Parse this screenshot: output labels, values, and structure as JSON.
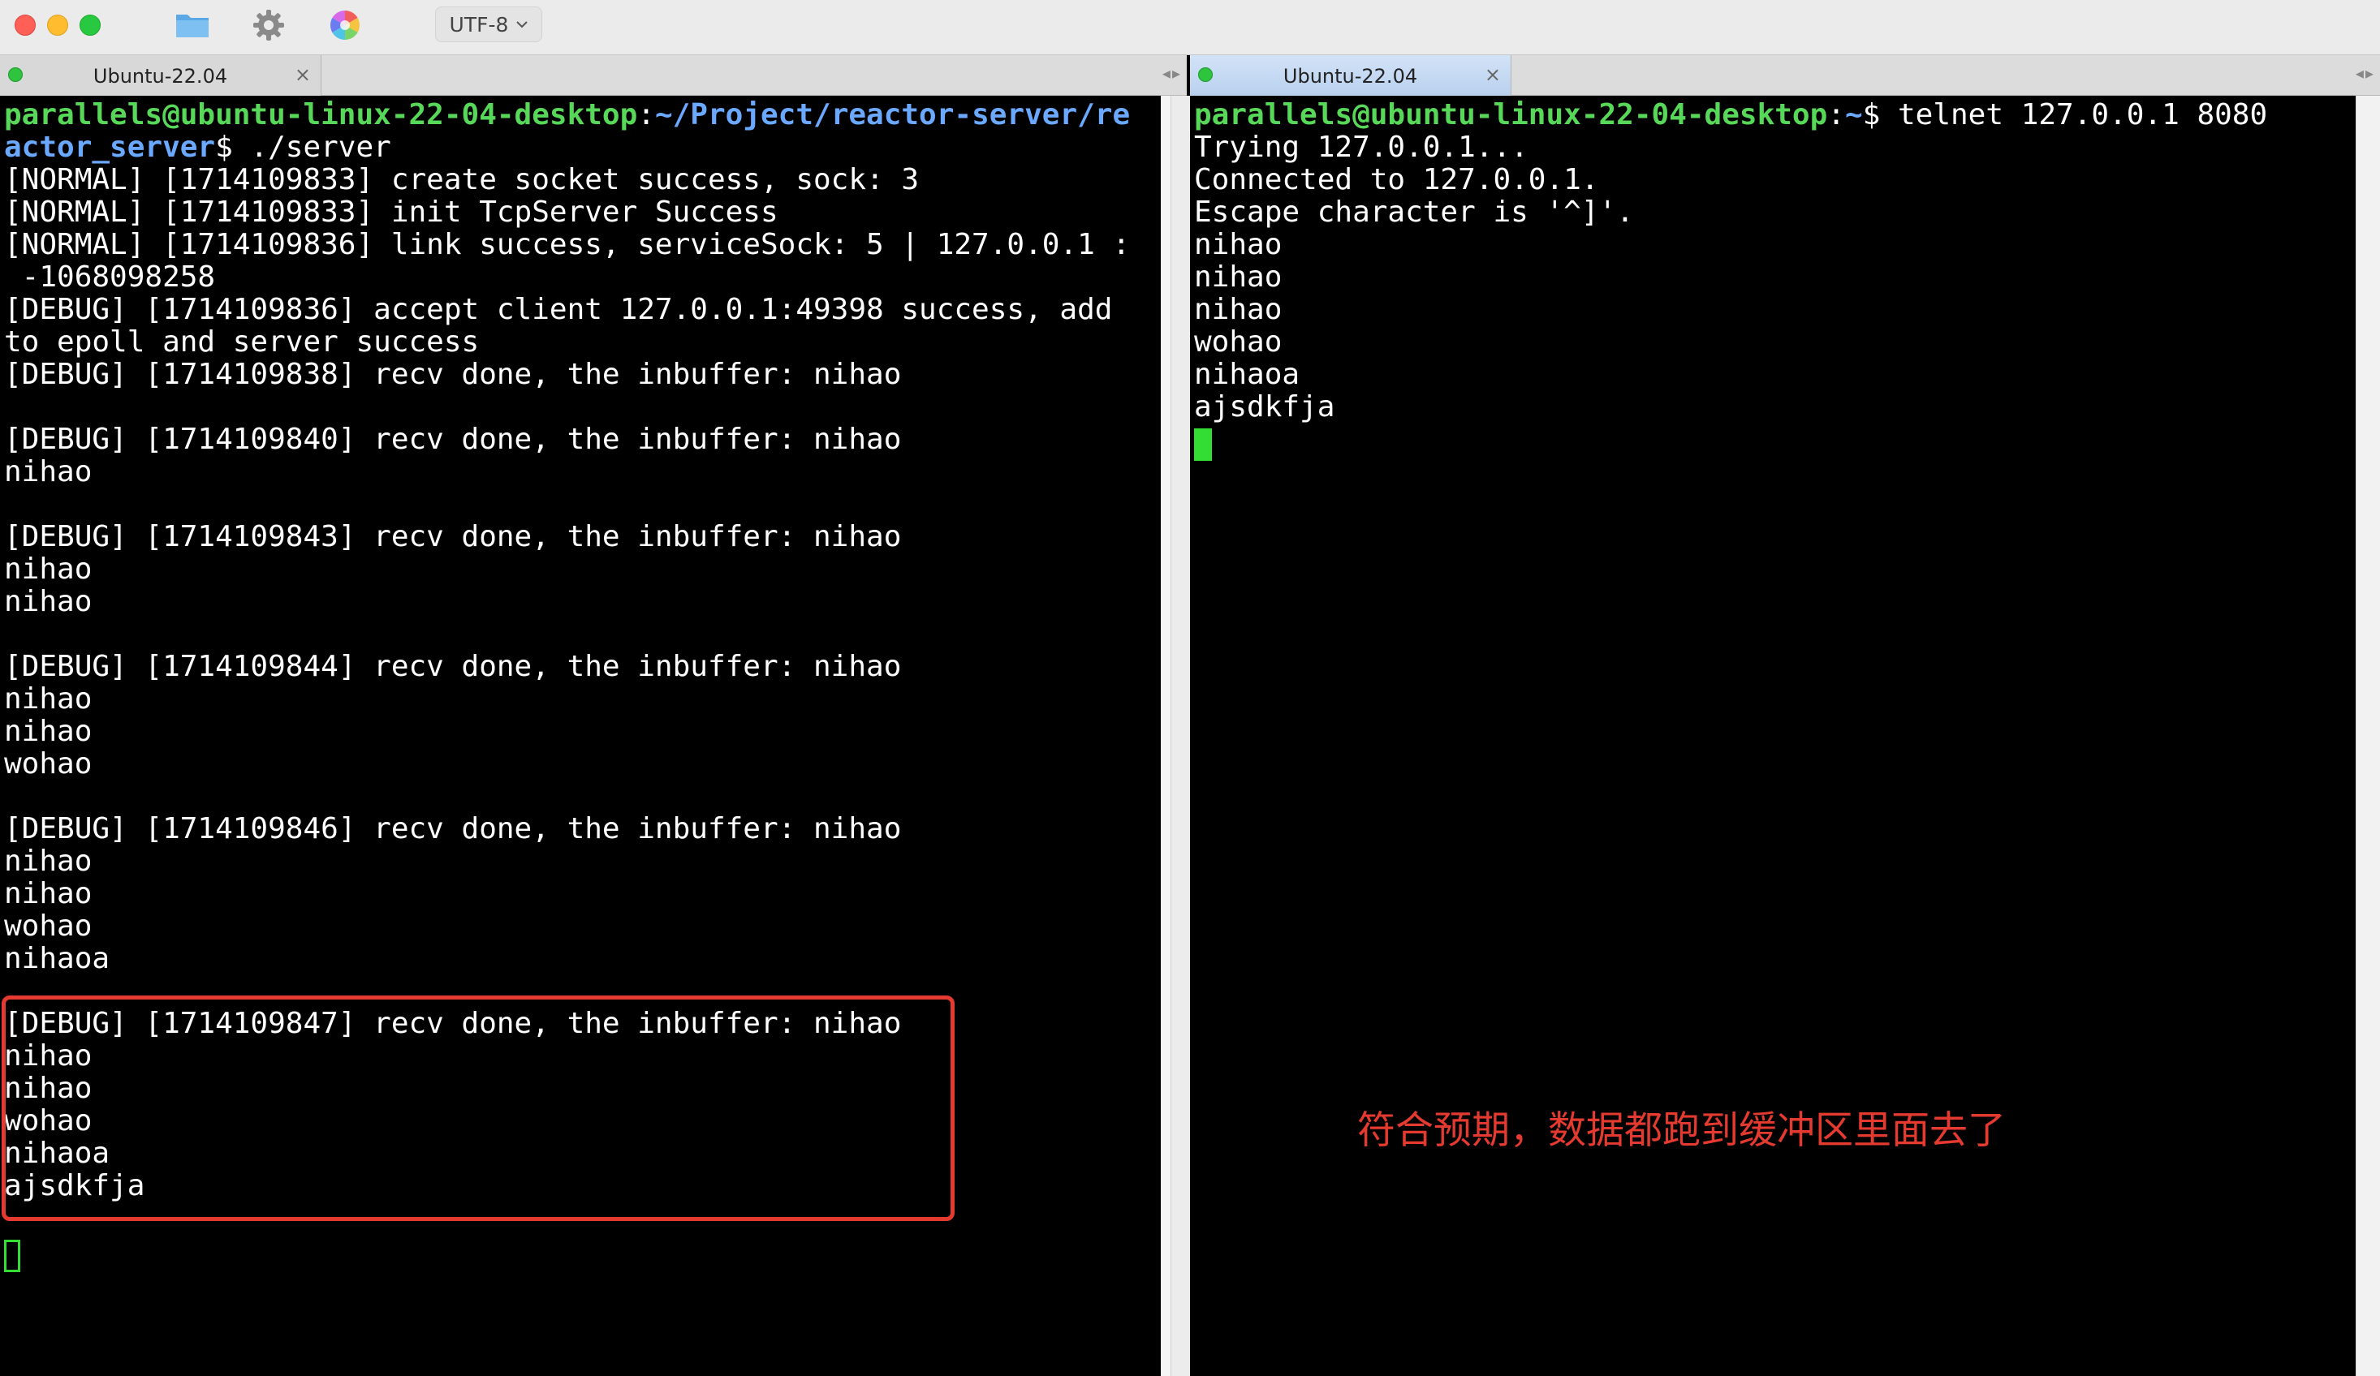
{
  "toolbar": {
    "encoding": "UTF-8",
    "icons": [
      "folder-icon",
      "gear-icon",
      "color-wheel-icon",
      "chevron-down-icon"
    ]
  },
  "tabs": {
    "left": {
      "title": "Ubuntu-22.04",
      "close": "×",
      "scroll": "◂▸"
    },
    "right": {
      "title": "Ubuntu-22.04",
      "close": "×",
      "scroll": "◂▸"
    }
  },
  "left_terminal": {
    "prompt_user": "parallels@ubuntu-linux-22-04-desktop",
    "prompt_sep": ":",
    "prompt_path_1": "~/Project/reactor-server/re",
    "prompt_path_2": "actor_server",
    "prompt_dollar_cmd": "$ ./server",
    "lines": [
      "[NORMAL] [1714109833] create socket success, sock: 3",
      "[NORMAL] [1714109833] init TcpServer Success",
      "[NORMAL] [1714109836] link success, serviceSock: 5 | 127.0.0.1 :",
      " -1068098258",
      "[DEBUG] [1714109836] accept client 127.0.0.1:49398 success, add",
      "to epoll and server success",
      "[DEBUG] [1714109838] recv done, the inbuffer: nihao",
      "",
      "[DEBUG] [1714109840] recv done, the inbuffer: nihao",
      "nihao",
      "",
      "[DEBUG] [1714109843] recv done, the inbuffer: nihao",
      "nihao",
      "nihao",
      "",
      "[DEBUG] [1714109844] recv done, the inbuffer: nihao",
      "nihao",
      "nihao",
      "wohao",
      "",
      "[DEBUG] [1714109846] recv done, the inbuffer: nihao",
      "nihao",
      "nihao",
      "wohao",
      "nihaoa",
      "",
      "[DEBUG] [1714109847] recv done, the inbuffer: nihao",
      "nihao",
      "nihao",
      "wohao",
      "nihaoa",
      "ajsdkfja",
      ""
    ]
  },
  "right_terminal": {
    "prompt_user": "parallels@ubuntu-linux-22-04-desktop",
    "prompt_sep": ":",
    "prompt_path": "~",
    "prompt_dollar_cmd": "$ telnet 127.0.0.1 8080",
    "lines": [
      "Trying 127.0.0.1...",
      "Connected to 127.0.0.1.",
      "Escape character is '^]'.",
      "nihao",
      "nihao",
      "nihao",
      "wohao",
      "nihaoa",
      "ajsdkfja"
    ]
  },
  "annotation": {
    "note": "符合预期，数据都跑到缓冲区里面去了",
    "color": "#e43a2f"
  }
}
